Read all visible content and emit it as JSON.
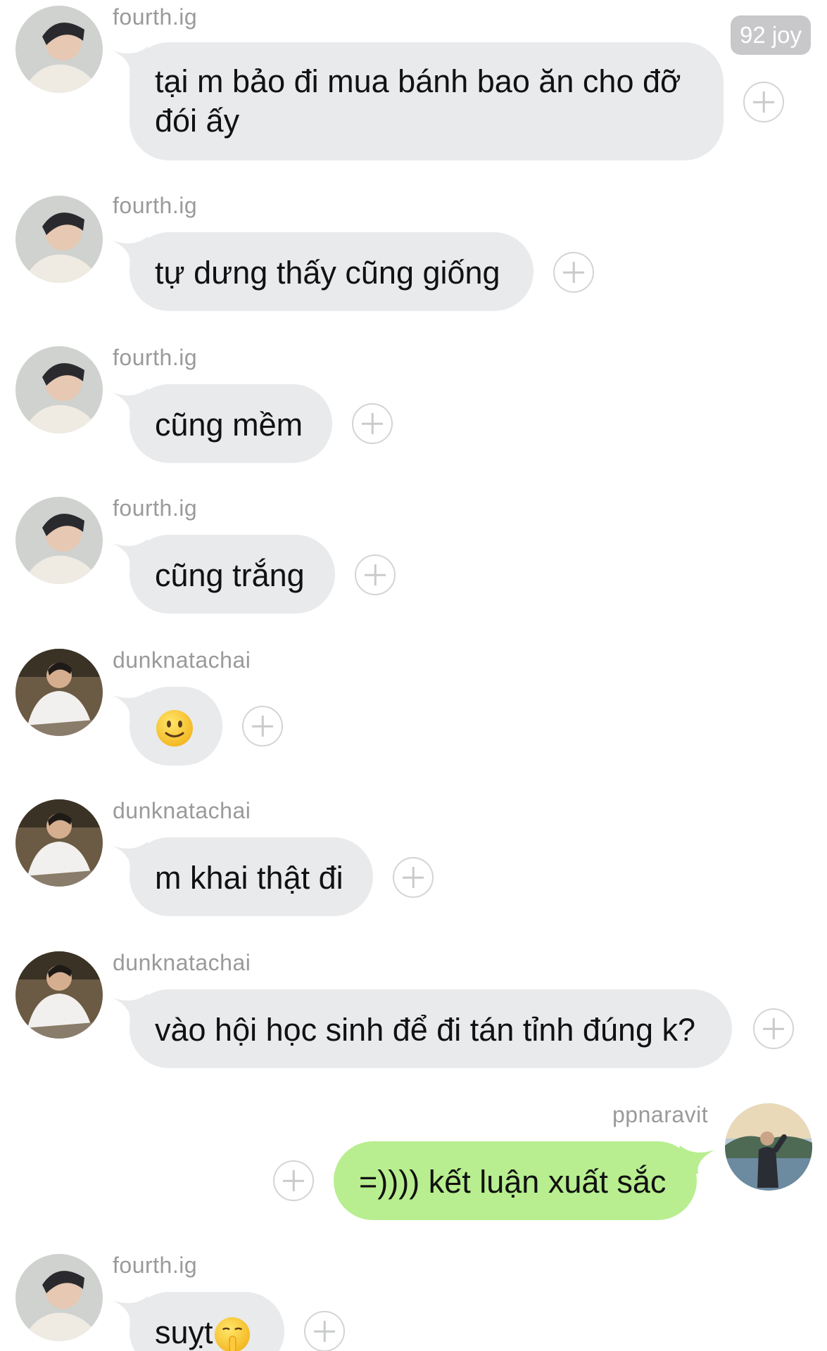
{
  "badge": {
    "text": "92 joy"
  },
  "messages": [
    {
      "user": "fourth.ig",
      "text": "tại m bảo đi mua bánh bao ăn cho đỡ đói ấy",
      "side": "left"
    },
    {
      "user": "fourth.ig",
      "text": "tự dưng thấy cũng giống",
      "side": "left"
    },
    {
      "user": "fourth.ig",
      "text": "cũng mềm",
      "side": "left"
    },
    {
      "user": "fourth.ig",
      "text": "cũng trắng",
      "side": "left"
    },
    {
      "user": "dunknatachai",
      "emoji": "slightly-smiling-face-emoji",
      "side": "left"
    },
    {
      "user": "dunknatachai",
      "text": "m khai thật đi",
      "side": "left"
    },
    {
      "user": "dunknatachai",
      "text": "vào hội học sinh để đi tán tỉnh đúng k?",
      "side": "left"
    },
    {
      "user": "ppnaravit",
      "text": "=)))) kết luận xuất sắc",
      "side": "right"
    },
    {
      "user": "fourth.ig",
      "text": "suỵt",
      "emoji": "shushing-face-emoji",
      "side": "left"
    }
  ],
  "colors": {
    "incoming_bubble": "#e9eaec",
    "outgoing_bubble": "#b8ee8f",
    "username": "#9a9a9a",
    "badge_bg": "#c8c8cb"
  },
  "icons": {
    "react_button": "plus-circle-icon"
  }
}
